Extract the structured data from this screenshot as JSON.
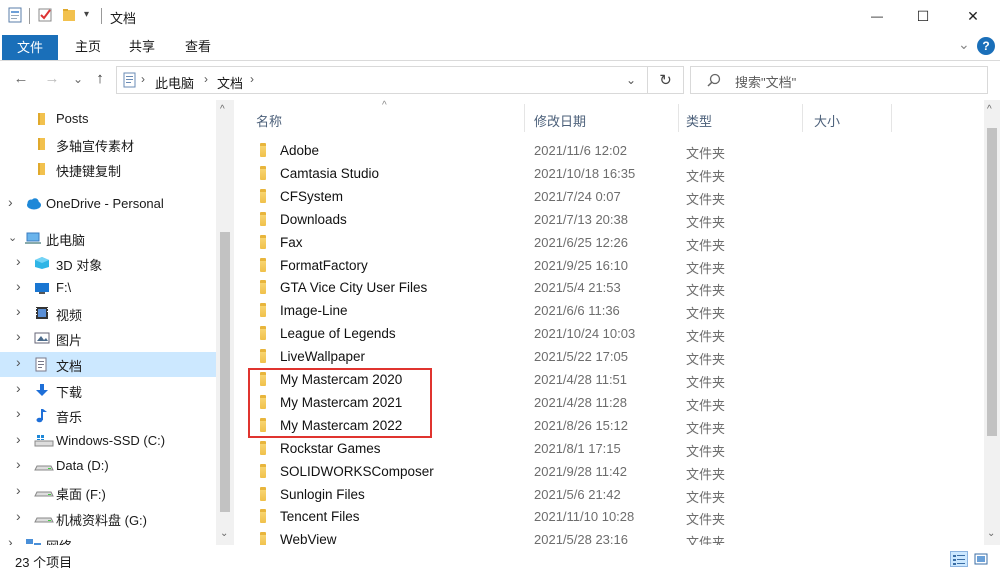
{
  "window": {
    "title": "文档",
    "minimize_glyph": "—",
    "maximize_glyph": "☐",
    "close_glyph": "✕"
  },
  "ribbon": {
    "tabs": [
      "文件",
      "主页",
      "共享",
      "查看"
    ],
    "expand_glyph": "⌄",
    "help_glyph": "?"
  },
  "nav": {
    "back_glyph": "←",
    "forward_glyph": "→",
    "recent_glyph": "⌄",
    "up_glyph": "↑",
    "breadcrumb": [
      "此电脑",
      "文档"
    ],
    "breadcrumb_sep": "›",
    "address_dropdown_glyph": "⌄",
    "refresh_glyph": "↻",
    "search_placeholder": "搜索\"文档\""
  },
  "sidebar": {
    "items": [
      {
        "label": "Posts",
        "icon": "folder-icon",
        "expandable": false,
        "indent": 1
      },
      {
        "label": "多轴宣传素材",
        "icon": "folder-icon",
        "expandable": false,
        "indent": 1
      },
      {
        "label": "快捷键复制",
        "icon": "folder-icon",
        "expandable": false,
        "indent": 1
      },
      {
        "label": "OneDrive - Personal",
        "icon": "cloud-icon",
        "expandable": true,
        "expanded": false,
        "indent": 0
      },
      {
        "label": "此电脑",
        "icon": "computer-icon",
        "expandable": true,
        "expanded": true,
        "indent": 0
      },
      {
        "label": "3D 对象",
        "icon": "cube-icon",
        "expandable": true,
        "expanded": false,
        "indent": 1
      },
      {
        "label": "F:\\",
        "icon": "desktop-icon",
        "expandable": true,
        "expanded": false,
        "indent": 1
      },
      {
        "label": "视频",
        "icon": "video-icon",
        "expandable": true,
        "expanded": false,
        "indent": 1
      },
      {
        "label": "图片",
        "icon": "picture-icon",
        "expandable": true,
        "expanded": false,
        "indent": 1
      },
      {
        "label": "文档",
        "icon": "document-icon",
        "expandable": true,
        "expanded": false,
        "indent": 1,
        "selected": true
      },
      {
        "label": "下载",
        "icon": "download-icon",
        "expandable": true,
        "expanded": false,
        "indent": 1
      },
      {
        "label": "音乐",
        "icon": "music-icon",
        "expandable": true,
        "expanded": false,
        "indent": 1
      },
      {
        "label": "Windows-SSD (C:)",
        "icon": "windows-drive-icon",
        "expandable": true,
        "expanded": false,
        "indent": 1
      },
      {
        "label": "Data (D:)",
        "icon": "drive-icon",
        "expandable": true,
        "expanded": false,
        "indent": 1
      },
      {
        "label": "桌面 (F:)",
        "icon": "drive-icon",
        "expandable": true,
        "expanded": false,
        "indent": 1
      },
      {
        "label": "机械资料盘 (G:)",
        "icon": "drive-icon",
        "expandable": true,
        "expanded": false,
        "indent": 1
      },
      {
        "label": "网络",
        "icon": "network-icon",
        "expandable": true,
        "expanded": false,
        "indent": 0
      }
    ]
  },
  "table": {
    "columns": [
      "名称",
      "修改日期",
      "类型",
      "大小"
    ],
    "sort_glyph": "^",
    "rows": [
      {
        "name": "Adobe",
        "date": "2021/11/6 12:02",
        "type": "文件夹"
      },
      {
        "name": "Camtasia Studio",
        "date": "2021/10/18 16:35",
        "type": "文件夹"
      },
      {
        "name": "CFSystem",
        "date": "2021/7/24 0:07",
        "type": "文件夹"
      },
      {
        "name": "Downloads",
        "date": "2021/7/13 20:38",
        "type": "文件夹"
      },
      {
        "name": "Fax",
        "date": "2021/6/25 12:26",
        "type": "文件夹"
      },
      {
        "name": "FormatFactory",
        "date": "2021/9/25 16:10",
        "type": "文件夹"
      },
      {
        "name": "GTA Vice City User Files",
        "date": "2021/5/4 21:53",
        "type": "文件夹"
      },
      {
        "name": "Image-Line",
        "date": "2021/6/6 11:36",
        "type": "文件夹"
      },
      {
        "name": "League of Legends",
        "date": "2021/10/24 10:03",
        "type": "文件夹"
      },
      {
        "name": "LiveWallpaper",
        "date": "2021/5/22 17:05",
        "type": "文件夹"
      },
      {
        "name": "My Mastercam 2020",
        "date": "2021/4/28 11:51",
        "type": "文件夹"
      },
      {
        "name": "My Mastercam 2021",
        "date": "2021/4/28 11:28",
        "type": "文件夹"
      },
      {
        "name": "My Mastercam 2022",
        "date": "2021/8/26 15:12",
        "type": "文件夹"
      },
      {
        "name": "Rockstar Games",
        "date": "2021/8/1 17:15",
        "type": "文件夹"
      },
      {
        "name": "SOLIDWORKSComposer",
        "date": "2021/9/28 11:42",
        "type": "文件夹"
      },
      {
        "name": "Sunlogin Files",
        "date": "2021/5/6 21:42",
        "type": "文件夹"
      },
      {
        "name": "Tencent Files",
        "date": "2021/11/10 10:28",
        "type": "文件夹"
      },
      {
        "name": "WebView",
        "date": "2021/5/28 23:16",
        "type": "文件夹"
      }
    ]
  },
  "scroll": {
    "up_glyph": "^",
    "down_glyph": "⌄"
  },
  "status": {
    "item_count": "23 个项目"
  },
  "colors": {
    "accent": "#1a6fb9",
    "selection": "#cce8ff",
    "highlight_box": "#e0342f",
    "folder": "#f0c04a"
  }
}
